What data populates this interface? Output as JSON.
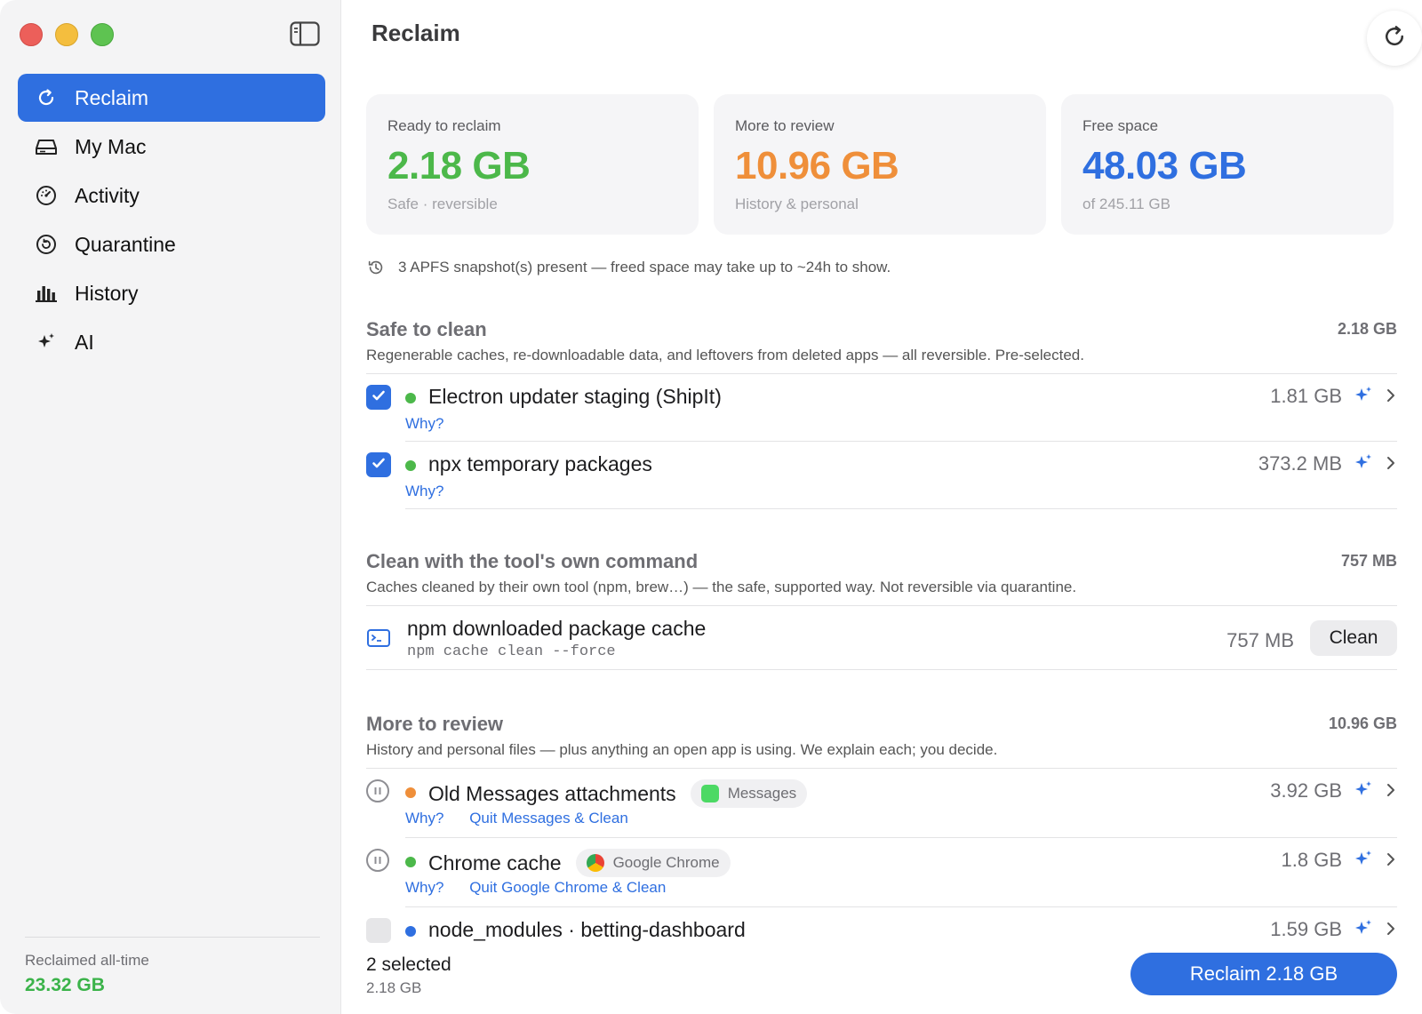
{
  "sidebar": {
    "items": [
      {
        "label": "Reclaim",
        "icon": "refresh-icon",
        "active": true
      },
      {
        "label": "My Mac",
        "icon": "drive-icon"
      },
      {
        "label": "Activity",
        "icon": "gauge-icon"
      },
      {
        "label": "Quarantine",
        "icon": "restore-icon"
      },
      {
        "label": "History",
        "icon": "bar-chart-icon"
      },
      {
        "label": "AI",
        "icon": "sparkle-icon"
      }
    ],
    "footer": {
      "label": "Reclaimed all-time",
      "value": "23.32 GB"
    }
  },
  "header": {
    "title": "Reclaim"
  },
  "cards": [
    {
      "label": "Ready to reclaim",
      "value": "2.18 GB",
      "sub": "Safe · reversible",
      "color": "#4cb84a"
    },
    {
      "label": "More to review",
      "value": "10.96 GB",
      "sub": "History & personal",
      "color": "#ef8f3a"
    },
    {
      "label": "Free space",
      "value": "48.03 GB",
      "sub": "of 245.11 GB",
      "color": "#2f6fe0"
    }
  ],
  "notice": "3 APFS snapshot(s) present — freed space may take up to ~24h to show.",
  "sections": {
    "safe": {
      "title": "Safe to clean",
      "total": "2.18 GB",
      "desc": "Regenerable caches, re-downloadable data, and leftovers from deleted apps — all reversible. Pre-selected.",
      "items": [
        {
          "title": "Electron updater staging (ShipIt)",
          "size": "1.81 GB",
          "why": "Why?",
          "checked": true
        },
        {
          "title": "npx temporary packages",
          "size": "373.2 MB",
          "why": "Why?",
          "checked": true
        }
      ]
    },
    "command": {
      "title": "Clean with the tool's own command",
      "total": "757 MB",
      "desc": "Caches cleaned by their own tool (npm, brew…) — the safe, supported way. Not reversible via quarantine.",
      "items": [
        {
          "title": "npm downloaded package cache",
          "code": "npm cache clean --force",
          "size": "757 MB",
          "button": "Clean"
        }
      ]
    },
    "review": {
      "title": "More to review",
      "total": "10.96 GB",
      "desc": "History and personal files — plus anything an open app is using. We explain each; you decide.",
      "items": [
        {
          "title": "Old Messages attachments",
          "chip": "Messages",
          "size": "3.92 GB",
          "why": "Why?",
          "action": "Quit Messages & Clean",
          "dot": "#ef8f3a"
        },
        {
          "title": "Chrome cache",
          "chip": "Google Chrome",
          "size": "1.8 GB",
          "why": "Why?",
          "action": "Quit Google Chrome & Clean",
          "dot": "#4cb84a"
        },
        {
          "title": "node_modules · betting-dashboard",
          "size": "1.59 GB",
          "dot": "#2f6fe0"
        }
      ]
    }
  },
  "footer": {
    "selected": "2 selected",
    "selected_size": "2.18 GB",
    "button": "Reclaim 2.18 GB"
  }
}
